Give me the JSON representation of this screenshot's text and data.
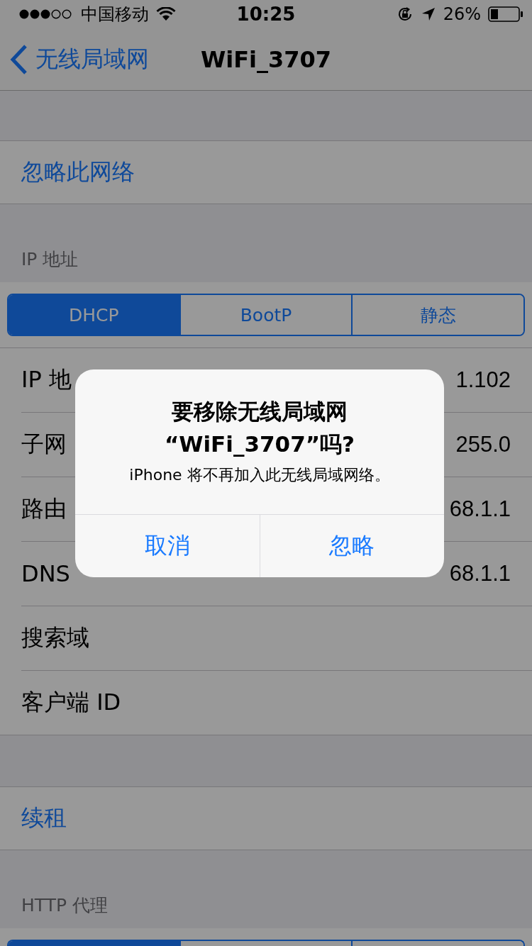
{
  "status_bar": {
    "carrier": "中国移动",
    "time": "10:25",
    "battery": "26%"
  },
  "nav": {
    "back": "无线局域网",
    "title": "WiFi_3707"
  },
  "forget_row": {
    "label": "忽略此网络"
  },
  "ip_section": {
    "header": "IP 地址",
    "segments": [
      {
        "label": "DHCP",
        "selected": true
      },
      {
        "label": "BootP",
        "selected": false
      },
      {
        "label": "静态",
        "selected": false
      }
    ],
    "rows": [
      {
        "label": "IP 地",
        "value": "1.102"
      },
      {
        "label": "子网",
        "value": "255.0"
      },
      {
        "label": "路由",
        "value": "68.1.1"
      },
      {
        "label": "DNS",
        "value": "68.1.1"
      },
      {
        "label": "搜索域"
      },
      {
        "label": "客户端 ID"
      }
    ]
  },
  "renew_row": {
    "label": "续租"
  },
  "proxy_section": {
    "header": "HTTP 代理",
    "segments": [
      {
        "selected": true
      },
      {
        "selected": false
      },
      {
        "selected": false
      }
    ]
  },
  "alert": {
    "title": "要移除无线局域网\n“WiFi_3707”吗?",
    "message": "iPhone 将不再加入此无线局域网络。",
    "buttons": [
      {
        "label": "取消"
      },
      {
        "label": "忽略"
      }
    ]
  }
}
